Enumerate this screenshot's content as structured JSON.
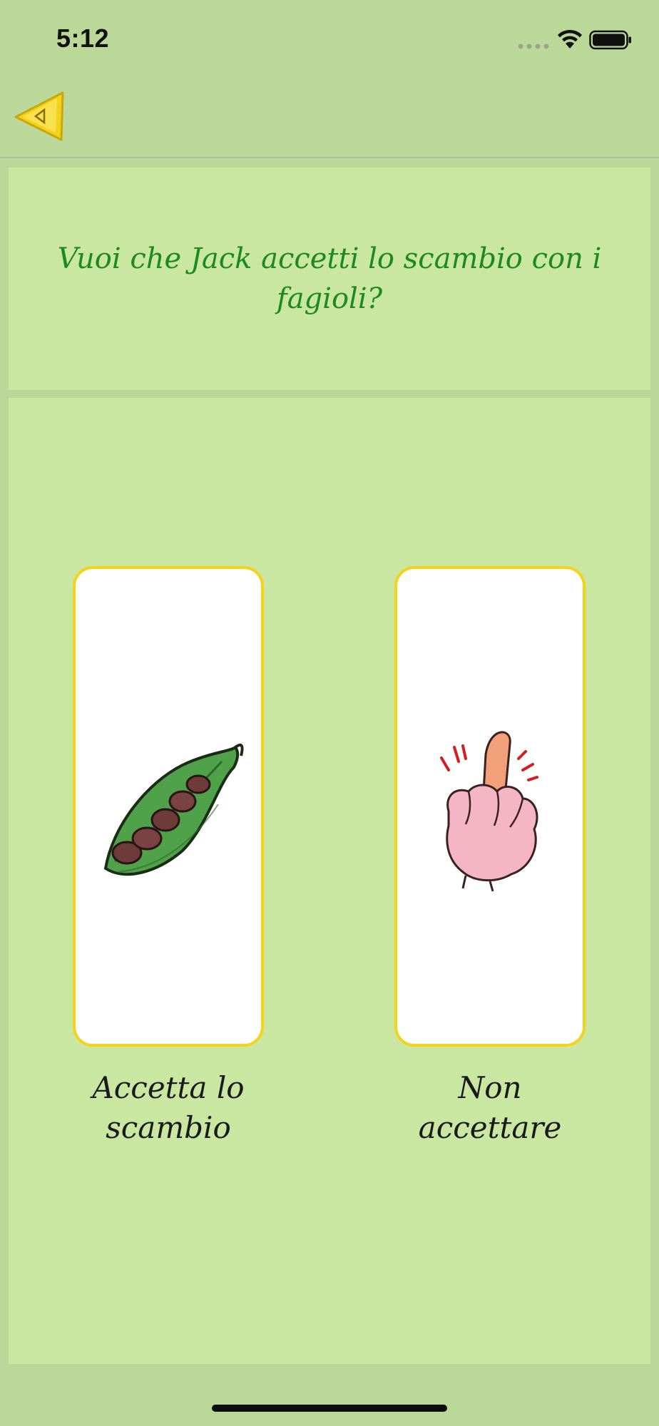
{
  "status_bar": {
    "time": "5:12",
    "icons": [
      "signal-icon",
      "wifi-icon",
      "battery-icon"
    ]
  },
  "nav": {
    "back_icon": "back-arrow-icon"
  },
  "question": {
    "text": "Vuoi che Jack accetti lo scambio con i fagioli?"
  },
  "choices": [
    {
      "label": "Accetta lo scambio",
      "illustration": "bean-pod-icon"
    },
    {
      "label": "Non accettare",
      "illustration": "raised-finger-hand-icon"
    }
  ],
  "colors": {
    "background": "#bcd898",
    "panel": "#cae7a2",
    "question_text": "#1e8a1e",
    "card_border": "#f5d21c",
    "back_arrow": "#f3d21a"
  }
}
